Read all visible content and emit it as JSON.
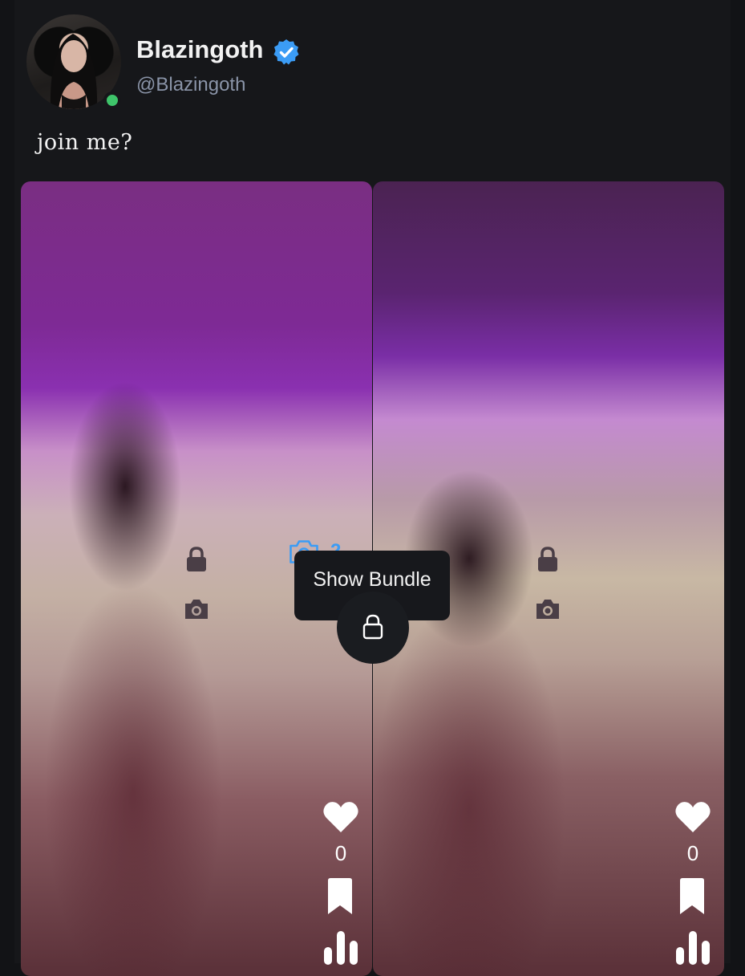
{
  "post": {
    "author_name": "Blazingoth",
    "author_handle": "@Blazingoth",
    "verified": true,
    "online": true,
    "caption": "join me?"
  },
  "bundle": {
    "photo_count": "2",
    "tooltip": "Show Bundle",
    "accent_color": "#3b9cf5"
  },
  "media": [
    {
      "likes": "0",
      "locked": true
    },
    {
      "likes": "0",
      "locked": true
    }
  ],
  "colors": {
    "background": "#16171a",
    "online": "#3ec46a",
    "verified": "#3b9cf5"
  }
}
